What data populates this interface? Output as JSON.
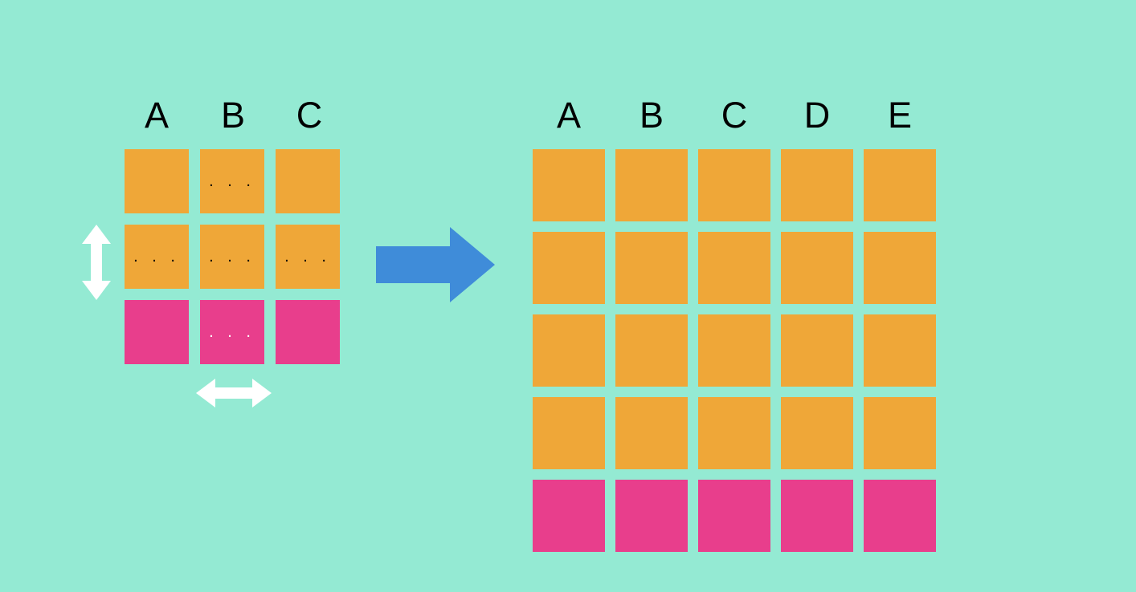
{
  "colors": {
    "background": "#94ead3",
    "orange": "#efa738",
    "pink": "#e83e8c",
    "arrow_blue": "#3f8cd9",
    "arrow_white": "#ffffff"
  },
  "left_grid": {
    "columns": [
      "A",
      "B",
      "C"
    ],
    "rows": [
      {
        "kind": "orange",
        "dots": [
          false,
          true,
          false
        ]
      },
      {
        "kind": "orange",
        "dots": [
          true,
          true,
          true
        ]
      },
      {
        "kind": "pink",
        "dots": [
          false,
          true,
          false
        ]
      }
    ],
    "dot_glyph": ". . ."
  },
  "right_grid": {
    "columns": [
      "A",
      "B",
      "C",
      "D",
      "E"
    ],
    "rows": [
      {
        "kind": "orange"
      },
      {
        "kind": "orange"
      },
      {
        "kind": "orange"
      },
      {
        "kind": "orange"
      },
      {
        "kind": "pink"
      }
    ]
  },
  "transform_arrow": "right",
  "expand_arrows": {
    "vertical": true,
    "horizontal": true
  },
  "meaning": "A 3-column, 3-row grid (2 orange rows + 1 pink row) expands both horizontally and vertically into a 5-column, 5-row grid (4 orange rows + 1 pink row)."
}
